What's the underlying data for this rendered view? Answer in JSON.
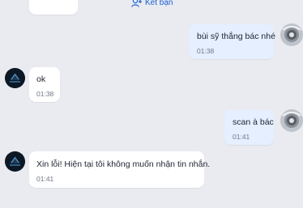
{
  "header": {
    "add_friend_label": "Kết bạn",
    "add_friend_icon": "add-user-icon"
  },
  "messages": [
    {
      "side": "mine",
      "text": "bùi sỹ thắng bác nhé",
      "time": "01:38"
    },
    {
      "side": "theirs",
      "text": "ok",
      "time": "01:38"
    },
    {
      "side": "mine",
      "text": "scan à bác",
      "time": "01:41"
    },
    {
      "side": "theirs",
      "text": "Xin lỗi! Hiện tại tôi không muốn nhận tin nhắn.",
      "time": "01:41"
    }
  ],
  "colors": {
    "background": "#e9ebf0",
    "my_bubble": "#e5efff",
    "their_bubble": "#ffffff",
    "accent": "#1a5fd6"
  }
}
